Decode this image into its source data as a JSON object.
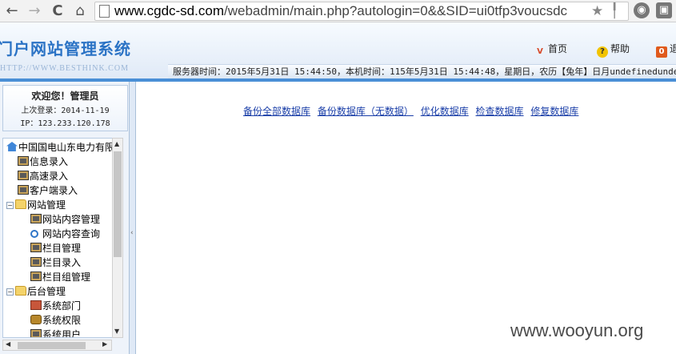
{
  "browser": {
    "url_host": "www.cgdc-sd.com",
    "url_path": "/webadmin/main.php?autologin=0&&SID=ui0tfp3voucsdc",
    "back": "←",
    "forward": "→",
    "reload": "C",
    "home": "⌂",
    "star": "★",
    "pin": "╿"
  },
  "header": {
    "logo": "门户网站管理系统",
    "logo_sub": "HTTP://WWW.BESTHINK.COM",
    "links": [
      {
        "label": "首页"
      },
      {
        "label": "帮助"
      },
      {
        "label": "退"
      }
    ],
    "timebar": "服务器时间：2015年5月31日 15:44:50，本机时间：115年5月31日 15:44:48，星期日，农历【兔年】日月undefinedundefined"
  },
  "left": {
    "welcome_title": "欢迎您！管理员",
    "last_login": "上次登录：2014-11-19",
    "ip": "IP：123.233.120.178",
    "tree": [
      {
        "label": "中国国电山东电力有限",
        "icon": "home-icon"
      },
      {
        "label": "信息录入",
        "icon": "app-icon"
      },
      {
        "label": "高速录入",
        "icon": "app-icon"
      },
      {
        "label": "客户端录入",
        "icon": "app-icon"
      },
      {
        "label": "网站管理",
        "icon": "folder-icon"
      },
      {
        "label": "网站内容管理",
        "icon": "app-icon"
      },
      {
        "label": "网站内容查询",
        "icon": "search-icon"
      },
      {
        "label": "栏目管理",
        "icon": "app-icon"
      },
      {
        "label": "栏目录入",
        "icon": "app-icon"
      },
      {
        "label": "栏目组管理",
        "icon": "app-icon"
      },
      {
        "label": "后台管理",
        "icon": "folder-icon"
      },
      {
        "label": "系统部门",
        "icon": "book-icon"
      },
      {
        "label": "系统权限",
        "icon": "key-icon"
      },
      {
        "label": "系统用户",
        "icon": "app-icon"
      }
    ]
  },
  "main": {
    "links": [
      {
        "label": "备份全部数据库"
      },
      {
        "label": "备份数据库（无数据）"
      },
      {
        "label": "优化数据库"
      },
      {
        "label": "检查数据库"
      },
      {
        "label": "修复数据库"
      }
    ]
  },
  "watermark": "www.wooyun.org"
}
